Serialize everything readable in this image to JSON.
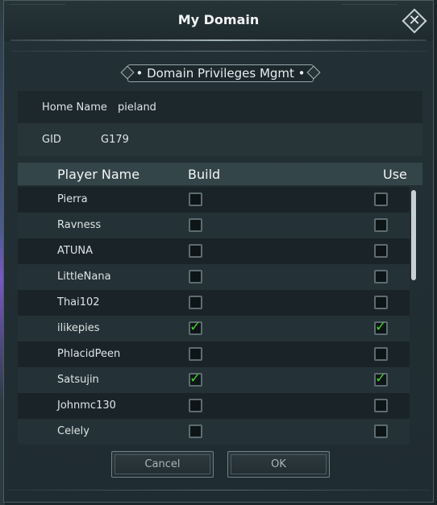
{
  "window": {
    "title": "My Domain"
  },
  "section": {
    "title": "Domain Privileges Mgmt"
  },
  "info": {
    "home_name_label": "Home Name",
    "home_name_value": "pieland",
    "gid_label": "GID",
    "gid_value": "G179"
  },
  "table": {
    "headers": {
      "player": "Player Name",
      "build": "Build",
      "use": "Use"
    },
    "rows": [
      {
        "name": "Pierra",
        "build": false,
        "use": false
      },
      {
        "name": "Ravness",
        "build": false,
        "use": false
      },
      {
        "name": "ATUNA",
        "build": false,
        "use": false
      },
      {
        "name": "LittleNana",
        "build": false,
        "use": false
      },
      {
        "name": "Thai102",
        "build": false,
        "use": false
      },
      {
        "name": "ilikepies",
        "build": true,
        "use": true
      },
      {
        "name": "PhlacidPeen",
        "build": false,
        "use": false
      },
      {
        "name": "Satsujin",
        "build": true,
        "use": true
      },
      {
        "name": "Johnmc130",
        "build": false,
        "use": false
      },
      {
        "name": "Celely",
        "build": false,
        "use": false
      }
    ]
  },
  "buttons": {
    "cancel": "Cancel",
    "ok": "OK"
  },
  "icons": {
    "close": "close-icon",
    "check": "check-icon"
  },
  "colors": {
    "check": "#42d12a",
    "header_bg": "#34454a"
  }
}
